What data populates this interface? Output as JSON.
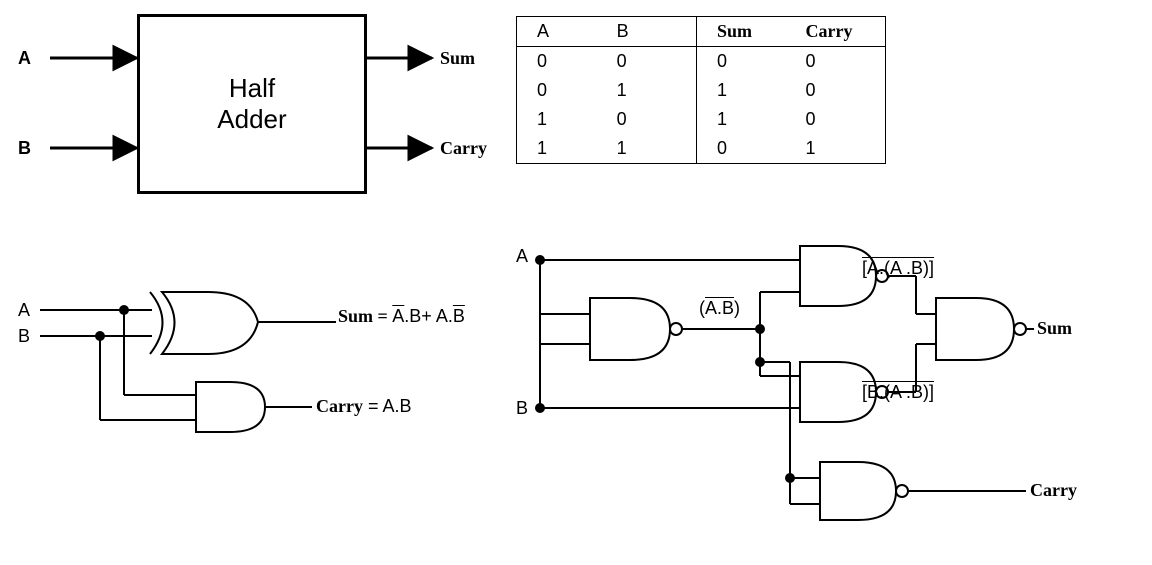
{
  "block": {
    "title_line1": "Half",
    "title_line2": "Adder",
    "input_a": "A",
    "input_b": "B",
    "output_sum": "Sum",
    "output_carry": "Carry"
  },
  "truth_table": {
    "headers": {
      "a": "A",
      "b": "B",
      "sum": "Sum",
      "carry": "Carry"
    },
    "rows": [
      {
        "a": "0",
        "b": "0",
        "sum": "0",
        "carry": "0"
      },
      {
        "a": "0",
        "b": "1",
        "sum": "1",
        "carry": "0"
      },
      {
        "a": "1",
        "b": "0",
        "sum": "1",
        "carry": "0"
      },
      {
        "a": "1",
        "b": "1",
        "sum": "0",
        "carry": "1"
      }
    ]
  },
  "xor_and_circuit": {
    "input_a": "A",
    "input_b": "B",
    "sum_prefix": "Sum = ",
    "sum_term1_over": "A",
    "sum_term1_txt": ".B+ A.",
    "sum_term2_over": "B",
    "carry_prefix": "Carry",
    "carry_eq": "  = A.B"
  },
  "nand_circuit": {
    "input_a": "A",
    "input_b": "B",
    "mid_open": "(",
    "mid_over": "A.B",
    "mid_close": ")",
    "top_open": "[A.(",
    "top_inner_over": "A .B",
    "top_close": ")]",
    "bot_open": "[B.(",
    "bot_inner_over": "A .B",
    "bot_close": ")]",
    "output_sum": "Sum",
    "output_carry": "Carry"
  }
}
